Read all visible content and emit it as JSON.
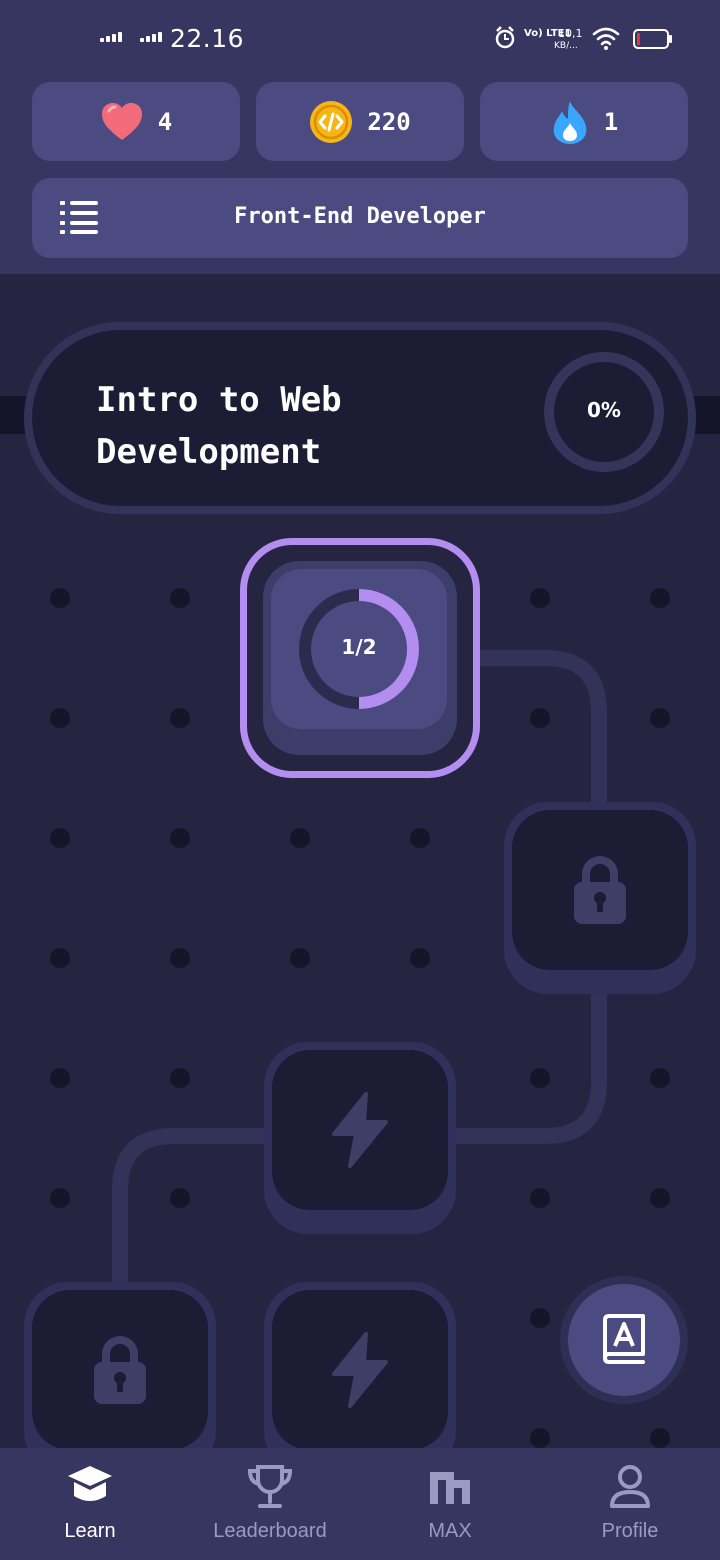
{
  "status_bar": {
    "time": "22.16",
    "network_label": "Vo) LTE1",
    "speed_value": "10,1",
    "speed_unit": "KB/...",
    "battery_level": 0.1
  },
  "stats": {
    "lives": "4",
    "coins": "220",
    "streak": "1"
  },
  "course": {
    "title": "Front-End Developer"
  },
  "unit": {
    "title": "Intro to Web Development",
    "progress_label": "0%"
  },
  "lesson": {
    "progress_label": "1/2",
    "progress_fraction": 0.5
  },
  "nav": {
    "items": [
      {
        "label": "Learn",
        "icon": "graduation-cap-icon",
        "active": true
      },
      {
        "label": "Leaderboard",
        "icon": "trophy-icon",
        "active": false
      },
      {
        "label": "MAX",
        "icon": "max-logo-icon",
        "active": false
      },
      {
        "label": "Profile",
        "icon": "person-icon",
        "active": false
      }
    ]
  },
  "colors": {
    "accent": "#b38df0",
    "header_bg": "#363660",
    "card_bg": "#4b4b82",
    "node_dark": "#1c1c35",
    "heart": "#f26b7a",
    "coin": "#f5b716",
    "flame": "#3aa7ff"
  }
}
